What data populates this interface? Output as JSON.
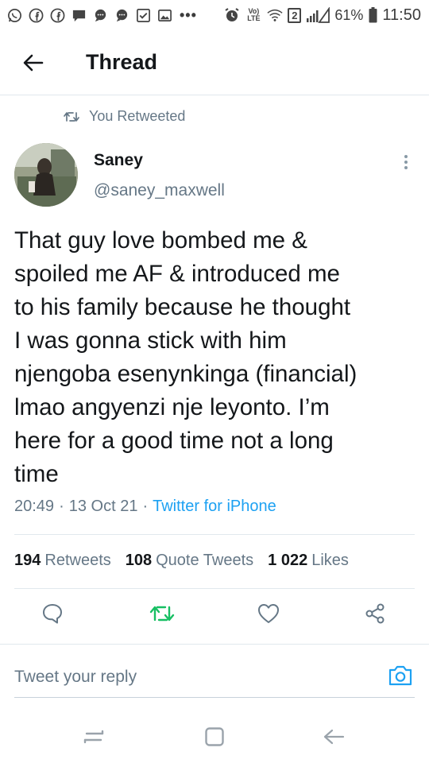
{
  "status_bar": {
    "left_icons": [
      "whatsapp-icon",
      "facebook-icon",
      "facebook-icon",
      "message-icon",
      "chat-icon",
      "chat-icon",
      "checkbox-icon",
      "gallery-icon"
    ],
    "more": "•••",
    "volte": "Vo) LTE",
    "sim": "2",
    "battery": "61%",
    "time": "11:50"
  },
  "header": {
    "title": "Thread"
  },
  "tweet": {
    "retweet_label": "You Retweeted",
    "author_name": "Saney",
    "author_handle": "@saney_maxwell",
    "text": "That guy love bombed me &\nspoiled me AF & introduced me\nto his family because he thought\nI was gonna stick with him\nnjengoba esenynkinga (financial)\nlmao angyenzi nje leyonto. I’m\nhere for a good time not a long\ntime",
    "time": "20:49",
    "sep1": "·",
    "date": "13 Oct 21",
    "sep2": "·",
    "source": "Twitter for iPhone"
  },
  "stats": {
    "retweets_count": "194",
    "retweets_label": "Retweets",
    "quotes_count": "108",
    "quotes_label": "Quote Tweets",
    "likes_count": "1 022",
    "likes_label": "Likes"
  },
  "reply": {
    "placeholder": "Tweet your reply"
  },
  "colors": {
    "accent": "#1da1f2",
    "retweeted": "#17bf63",
    "secondary_text": "#657786",
    "primary_text": "#14171a",
    "divider": "#e1e8ed"
  }
}
